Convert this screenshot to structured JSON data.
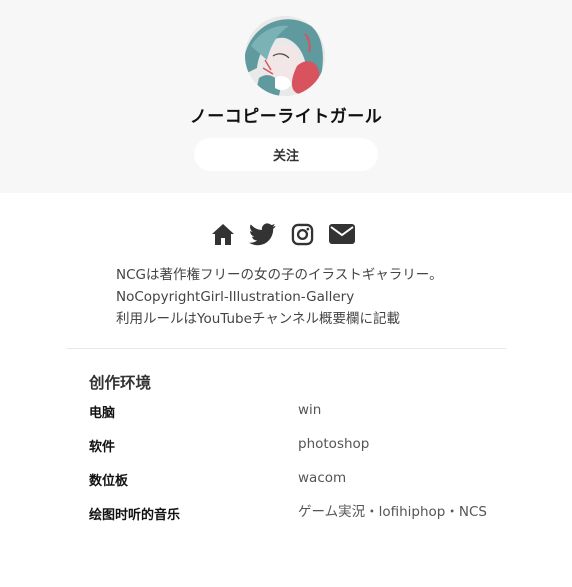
{
  "profile": {
    "name": "ノーコピーライトガール",
    "follow_label": "关注"
  },
  "social": {
    "icons": [
      "home-icon",
      "twitter-icon",
      "instagram-icon",
      "mail-icon"
    ],
    "color": "#333333"
  },
  "bio": {
    "line1": "NCGは著作権フリーの女の子のイラストギャラリー。",
    "line2": "NoCopyrightGirl-Illustration-Gallery",
    "line3": "利用ルールはYouTubeチャンネル概要欄に記載"
  },
  "environment": {
    "title": "创作环境",
    "items": [
      {
        "label": "电脑",
        "value": "win"
      },
      {
        "label": "软件",
        "value": "photoshop"
      },
      {
        "label": "数位板",
        "value": "wacom"
      },
      {
        "label": "绘图时听的音乐",
        "value": "ゲーム実況・lofihiphop・NCS"
      }
    ]
  },
  "colors": {
    "header_bg": "#f7f7f7",
    "avatar_hair": "#5e9a9e",
    "avatar_accent": "#d9535f"
  }
}
